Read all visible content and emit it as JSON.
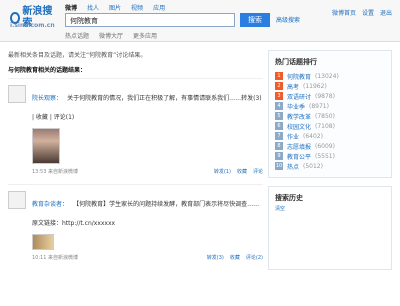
{
  "header": {
    "logo": {
      "brand": "新浪搜索",
      "sub": "i.sina.com.cn"
    },
    "nav": [
      "微博",
      "找人",
      "图片",
      "视频",
      "应用"
    ],
    "search": {
      "value": "何院教育"
    },
    "search_button": "搜索",
    "advanced": "高级搜索",
    "subtabs": [
      "热点话题",
      "微博大厅",
      "更多应用"
    ],
    "toplinks": [
      "微博首页",
      "设置",
      "退出"
    ]
  },
  "content": {
    "intro": "最新相关条目及话题，请关注“何院教育”讨论结果。",
    "section_title": "与何院教育相关的话题结果：",
    "posts": [
      {
        "name": "院长观察：",
        "text": "关于何院教育的情况，我们正在积极了解，有事情请联系我们……转发(3) | 收藏 | 评论(1)",
        "meta": "13:53 来自新浪微博",
        "actions": [
          "转发(1)",
          "收藏",
          "评论"
        ]
      },
      {
        "name": "教育杂谈者：",
        "text": "【何院教育】学生家长的问题持续发酵，教育部门表示将尽快调查……原文链接：http://t.cn/xxxxxx",
        "meta": "10:11 来自新浪微博",
        "actions": [
          "转发(3)",
          "收藏",
          "评论(2)"
        ]
      }
    ]
  },
  "sidebar": {
    "hot_title": "热门话题排行",
    "hot": [
      {
        "rank": "1",
        "title": "何院教育",
        "count": "(13024)"
      },
      {
        "rank": "2",
        "title": "高考",
        "count": "(11962)"
      },
      {
        "rank": "3",
        "title": "双语研讨",
        "count": "(9878)"
      },
      {
        "rank": "4",
        "title": "毕业季",
        "count": "(8971)"
      },
      {
        "rank": "5",
        "title": "教学改革",
        "count": "(7850)"
      },
      {
        "rank": "6",
        "title": "校园文化",
        "count": "(7108)"
      },
      {
        "rank": "7",
        "title": "作业",
        "count": "(6402)"
      },
      {
        "rank": "8",
        "title": "志愿填报",
        "count": "(6009)"
      },
      {
        "rank": "9",
        "title": "教育公平",
        "count": "(5551)"
      },
      {
        "rank": "10",
        "title": "热点",
        "count": "(5012)"
      }
    ],
    "box2_title": "搜索历史",
    "box2_link": "清空"
  }
}
